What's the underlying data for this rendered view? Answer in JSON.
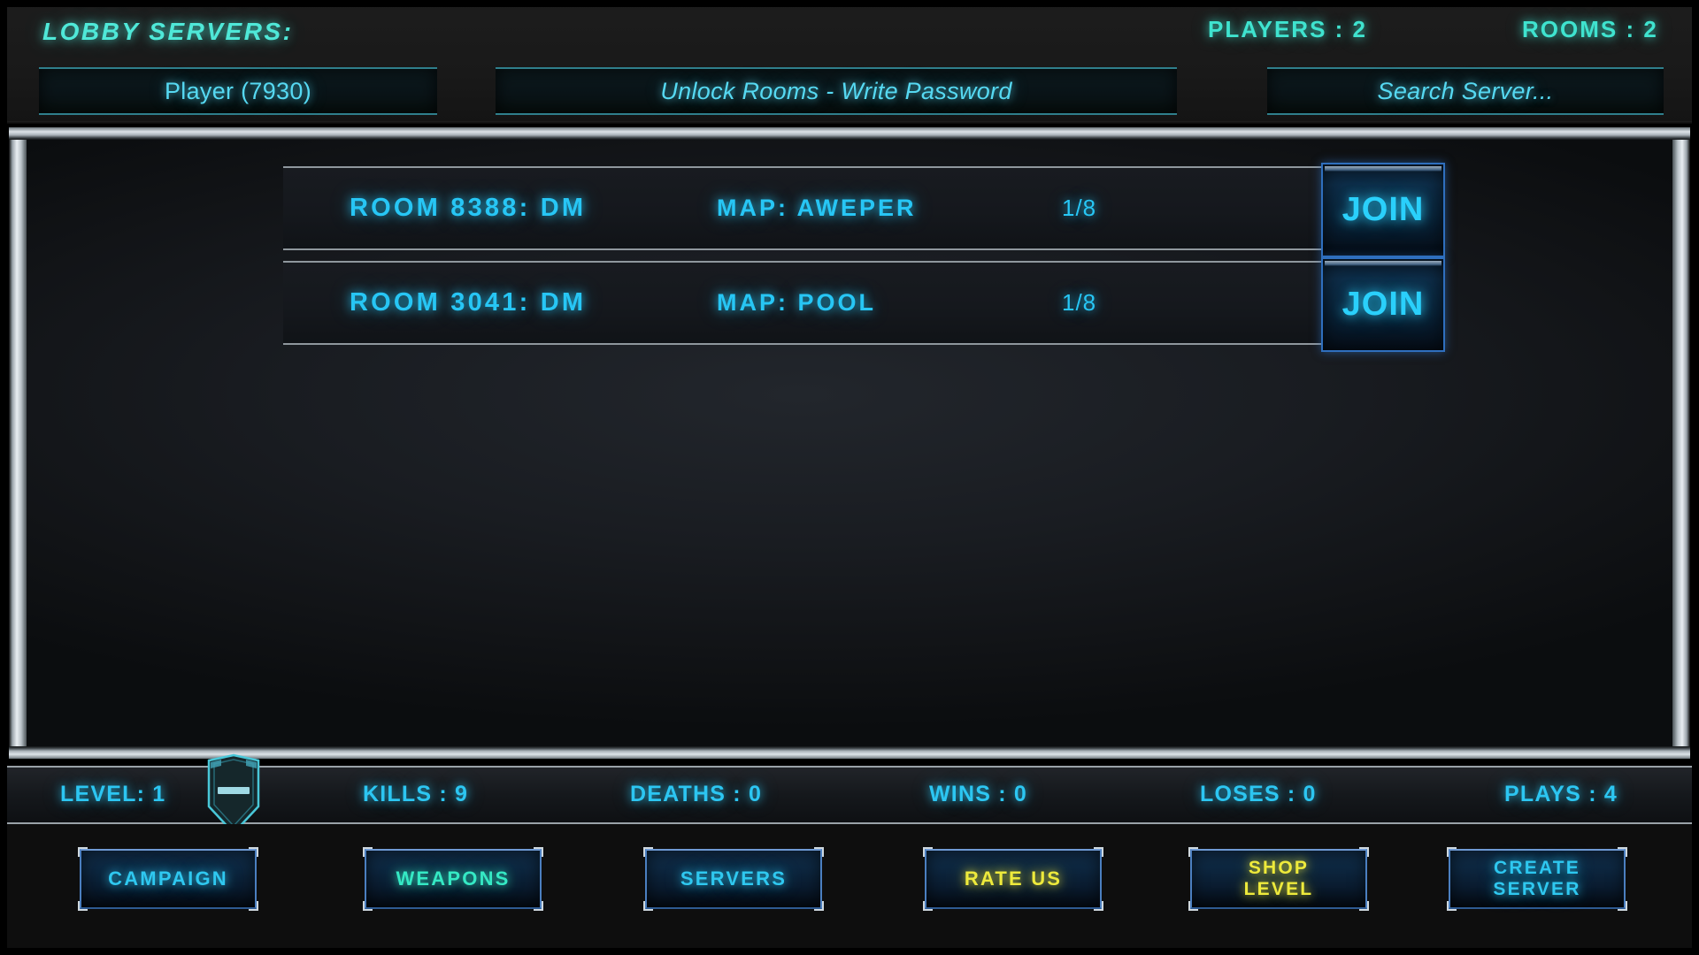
{
  "header": {
    "title": "LOBBY SERVERS:",
    "players_stat": "PLAYERS : 2",
    "rooms_stat": "ROOMS : 2",
    "fields": {
      "player_name": "Player (7930)",
      "password_placeholder": "Unlock Rooms - Write Password",
      "search_placeholder": "Search  Server..."
    }
  },
  "rooms": [
    {
      "name": "ROOM 8388: DM",
      "map": "MAP: AWEPER",
      "slots": "1/8",
      "join_label": "JOIN"
    },
    {
      "name": "ROOM 3041: DM",
      "map": "MAP: POOL",
      "slots": "1/8",
      "join_label": "JOIN"
    }
  ],
  "stats": {
    "level": "LEVEL: 1",
    "kills": "KILLS : 9",
    "deaths": "DEATHS : 0",
    "wins": "WINS : 0",
    "loses": "LOSES : 0",
    "plays": "PLAYS : 4",
    "rank_badge_icon": "shield-rank-icon"
  },
  "nav_buttons": [
    {
      "line1": "CAMPAIGN",
      "line2": "",
      "color": "cyan"
    },
    {
      "line1": "WEAPONS",
      "line2": "",
      "color": "green"
    },
    {
      "line1": "SERVERS",
      "line2": "",
      "color": "cyan"
    },
    {
      "line1": "RATE US",
      "line2": "",
      "color": "yellow"
    },
    {
      "line1": "SHOP",
      "line2": "LEVEL",
      "color": "yellow"
    },
    {
      "line1": "CREATE",
      "line2": "SERVER",
      "color": "cyan"
    }
  ],
  "colors": {
    "accent_cyan": "#27c6f5",
    "accent_green": "#35e9c4",
    "accent_yellow": "#eeea3c",
    "frame_silver": "#dde4e9",
    "panel_bg": "#15181d"
  }
}
